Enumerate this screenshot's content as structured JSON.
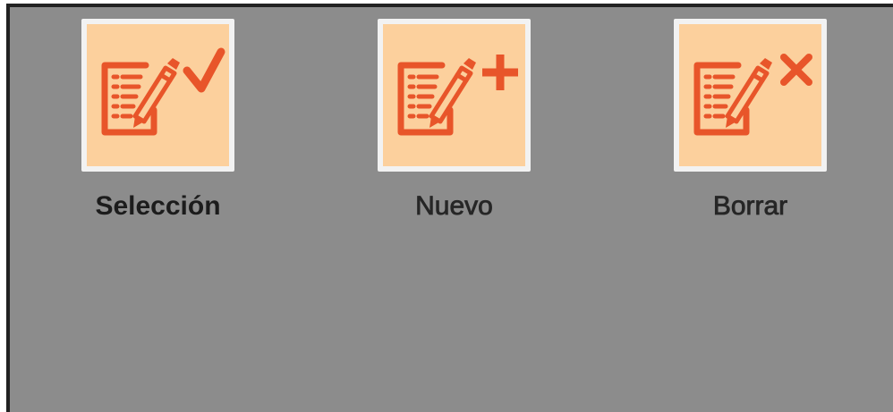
{
  "colors": {
    "panel_background": "#8c8c8c",
    "tile_background": "#fcd09d",
    "tile_frame": "#f2f2f2",
    "icon_accent": "#e8552a",
    "label_text": "#1c1c1c"
  },
  "tiles": [
    {
      "label": "Selección",
      "icon": "document-edit-check-icon"
    },
    {
      "label": "Nuevo",
      "icon": "document-edit-plus-icon"
    },
    {
      "label": "Borrar",
      "icon": "document-edit-delete-icon"
    }
  ]
}
